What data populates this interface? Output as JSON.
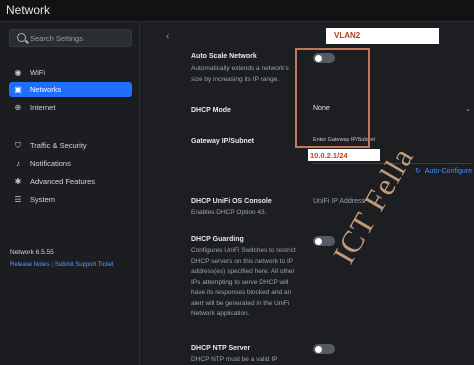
{
  "window": {
    "title": "Network"
  },
  "sidebar": {
    "search_placeholder": "Search Settings",
    "items": [
      {
        "label": "WiFi",
        "icon": "wifi-icon"
      },
      {
        "label": "Networks",
        "icon": "network-icon",
        "active": true
      },
      {
        "label": "Internet",
        "icon": "globe-icon"
      },
      {
        "label": "Traffic & Security",
        "icon": "shield-icon"
      },
      {
        "label": "Notifications",
        "icon": "bell-icon"
      },
      {
        "label": "Advanced Features",
        "icon": "wrench-icon"
      },
      {
        "label": "System",
        "icon": "server-icon"
      }
    ],
    "version": "Network 6.5.55",
    "release_notes": "Release Notes",
    "submit_ticket": "Submit Support Ticket"
  },
  "main": {
    "network_name": "VLAN2",
    "auto_scale": {
      "label": "Auto Scale Network",
      "description": "Automatically extends a network's size by increasing its IP range.",
      "enabled": false
    },
    "dhcp_mode": {
      "label": "DHCP Mode",
      "value": "None"
    },
    "gateway": {
      "label": "Gateway IP/Subnet",
      "placeholder": "Enter Gateway IP/Subnet",
      "value": "10.0.2.1/24"
    },
    "auto_configure": "Auto-Configure",
    "dhcp_console": {
      "label": "DHCP UniFi OS Console",
      "description": "Enables DHCP Option 43.",
      "placeholder": "UniFi IP Address"
    },
    "dhcp_guarding": {
      "label": "DHCP Guarding",
      "description_lines": [
        "Configures UniFi Switches to restrict",
        "DHCP servers on this network to IP",
        "address(es) specified here. All other",
        "IPs attempting to serve DHCP will",
        "have its responses blocked and an",
        "alert will be generated in the UniFi",
        "Network application."
      ],
      "enabled": false
    },
    "dhcp_ntp": {
      "label": "DHCP NTP Server",
      "description": "DHCP NTP must be a valid IP",
      "enabled": false
    }
  },
  "watermark": "ICT Fella",
  "colors": {
    "accent": "#1f6fff",
    "highlight_border": "#c07a56",
    "annotation_text": "#c0451c"
  }
}
